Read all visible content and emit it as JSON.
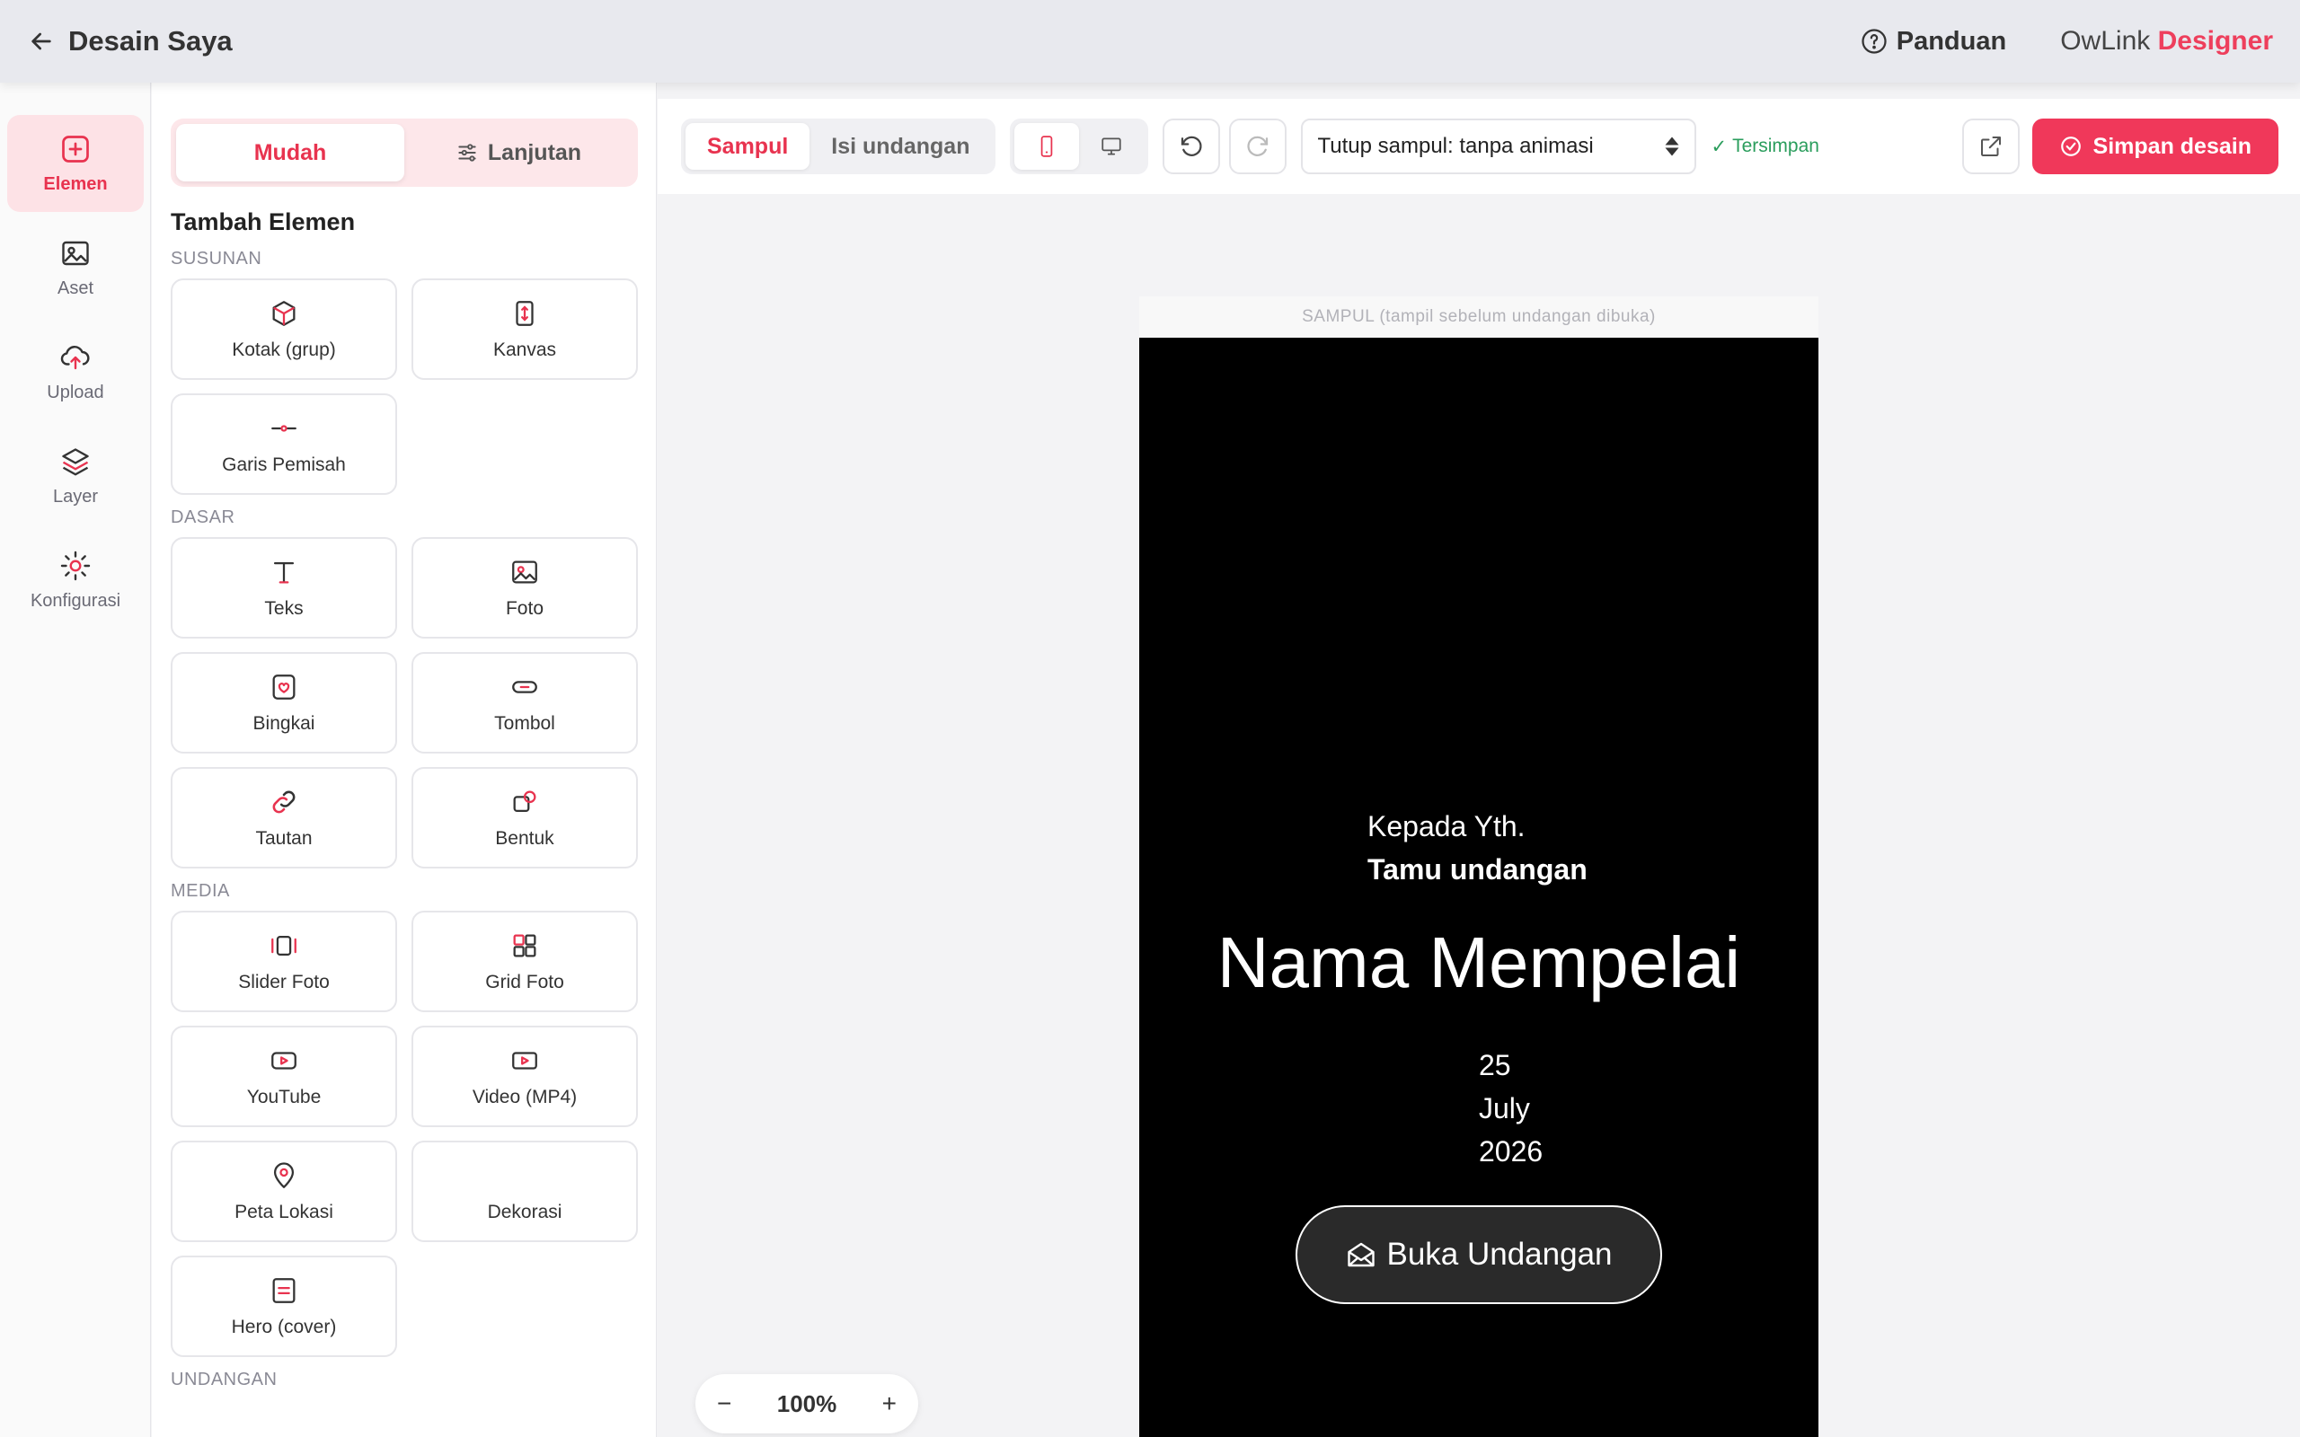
{
  "header": {
    "back_label": "Desain Saya",
    "guide_label": "Panduan",
    "brand_prefix": "OwLink",
    "brand_accent": "Designer"
  },
  "rail": {
    "items": [
      {
        "label": "Elemen",
        "icon": "plus-square-icon"
      },
      {
        "label": "Aset",
        "icon": "image-icon"
      },
      {
        "label": "Upload",
        "icon": "upload-cloud-icon"
      },
      {
        "label": "Layer",
        "icon": "layers-icon"
      },
      {
        "label": "Konfigurasi",
        "icon": "gear-icon"
      }
    ]
  },
  "panel": {
    "mode_easy": "Mudah",
    "mode_advanced": "Lanjutan",
    "title": "Tambah Elemen",
    "sections": {
      "susunan": {
        "label": "SUSUNAN",
        "items": [
          "Kotak (grup)",
          "Kanvas",
          "Garis Pemisah"
        ]
      },
      "dasar": {
        "label": "DASAR",
        "items": [
          "Teks",
          "Foto",
          "Bingkai",
          "Tombol",
          "Tautan",
          "Bentuk"
        ]
      },
      "media": {
        "label": "MEDIA",
        "items": [
          "Slider Foto",
          "Grid Foto",
          "YouTube",
          "Video (MP4)",
          "Peta Lokasi",
          "Dekorasi",
          "Hero (cover)"
        ]
      },
      "undangan": {
        "label": "UNDANGAN"
      }
    }
  },
  "toolbar": {
    "tab_cover": "Sampul",
    "tab_content": "Isi undangan",
    "cover_select": "Tutup sampul: tanpa animasi",
    "saved_status": "Tersimpan",
    "save_button": "Simpan desain"
  },
  "canvas": {
    "cover_hint": "SAMPUL (tampil sebelum undangan dibuka)",
    "to_line": "Kepada Yth.",
    "guest_name": "Tamu undangan",
    "couple_name": "Nama Mempelai",
    "date_day": "25",
    "date_month": "July",
    "date_year": "2026",
    "open_button": "Buka Undangan"
  },
  "zoom": {
    "minus": "−",
    "value": "100%",
    "plus": "+"
  },
  "colors": {
    "accent": "#ee3f5c",
    "accent_soft": "#fde2e6",
    "saved_green": "#2a9d5c"
  }
}
